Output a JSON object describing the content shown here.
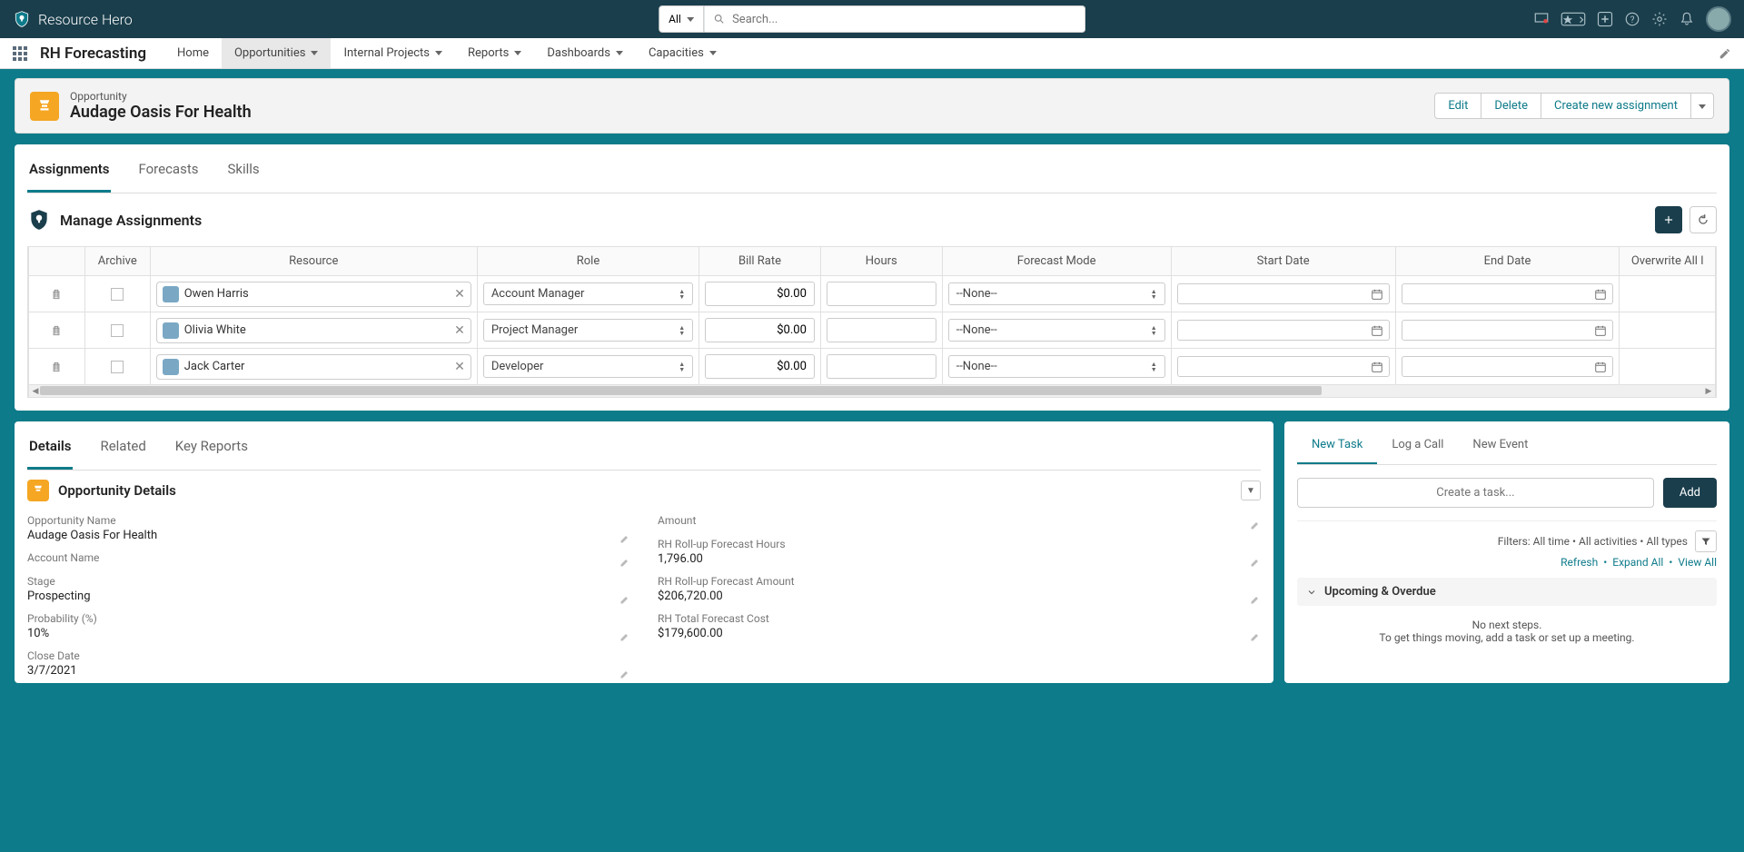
{
  "header": {
    "brand": "Resource Hero",
    "search_scope": "All",
    "search_placeholder": "Search..."
  },
  "nav": {
    "app_name": "RH Forecasting",
    "items": [
      "Home",
      "Opportunities",
      "Internal Projects",
      "Reports",
      "Dashboards",
      "Capacities"
    ],
    "active_index": 1
  },
  "record": {
    "type": "Opportunity",
    "title": "Audage Oasis For Health",
    "actions": [
      "Edit",
      "Delete",
      "Create new assignment"
    ]
  },
  "tabs_main": {
    "items": [
      "Assignments",
      "Forecasts",
      "Skills"
    ],
    "active_index": 0
  },
  "assignments": {
    "section_title": "Manage Assignments",
    "columns": [
      "",
      "Archive",
      "Resource",
      "Role",
      "Bill Rate",
      "Hours",
      "Forecast Mode",
      "Start Date",
      "End Date",
      "Overwrite All I"
    ],
    "rows": [
      {
        "resource": "Owen Harris",
        "role": "Account Manager",
        "bill_rate": "$0.00",
        "hours": "",
        "forecast_mode": "--None--",
        "start_date": "",
        "end_date": ""
      },
      {
        "resource": "Olivia White",
        "role": "Project Manager",
        "bill_rate": "$0.00",
        "hours": "",
        "forecast_mode": "--None--",
        "start_date": "",
        "end_date": ""
      },
      {
        "resource": "Jack Carter",
        "role": "Developer",
        "bill_rate": "$0.00",
        "hours": "",
        "forecast_mode": "--None--",
        "start_date": "",
        "end_date": ""
      }
    ]
  },
  "tabs_lower": {
    "items": [
      "Details",
      "Related",
      "Key Reports"
    ],
    "active_index": 0
  },
  "details": {
    "section_title": "Opportunity Details",
    "left": [
      {
        "label": "Opportunity Name",
        "value": "Audage Oasis For Health"
      },
      {
        "label": "Account Name",
        "value": ""
      },
      {
        "label": "Stage",
        "value": "Prospecting"
      },
      {
        "label": "Probability (%)",
        "value": "10%"
      },
      {
        "label": "Close Date",
        "value": "3/7/2021"
      }
    ],
    "right": [
      {
        "label": "Amount",
        "value": ""
      },
      {
        "label": "RH Roll-up Forecast Hours",
        "value": "1,796.00"
      },
      {
        "label": "RH Roll-up Forecast Amount",
        "value": "$206,720.00"
      },
      {
        "label": "RH Total Forecast Cost",
        "value": "$179,600.00"
      }
    ]
  },
  "activity": {
    "tabs": [
      "New Task",
      "Log a Call",
      "New Event"
    ],
    "active_index": 0,
    "task_placeholder": "Create a task...",
    "add_label": "Add",
    "filter_text": "Filters: All time • All activities • All types",
    "links": [
      "Refresh",
      "Expand All",
      "View All"
    ],
    "upcoming_title": "Upcoming & Overdue",
    "empty_line1": "No next steps.",
    "empty_line2": "To get things moving, add a task or set up a meeting."
  }
}
